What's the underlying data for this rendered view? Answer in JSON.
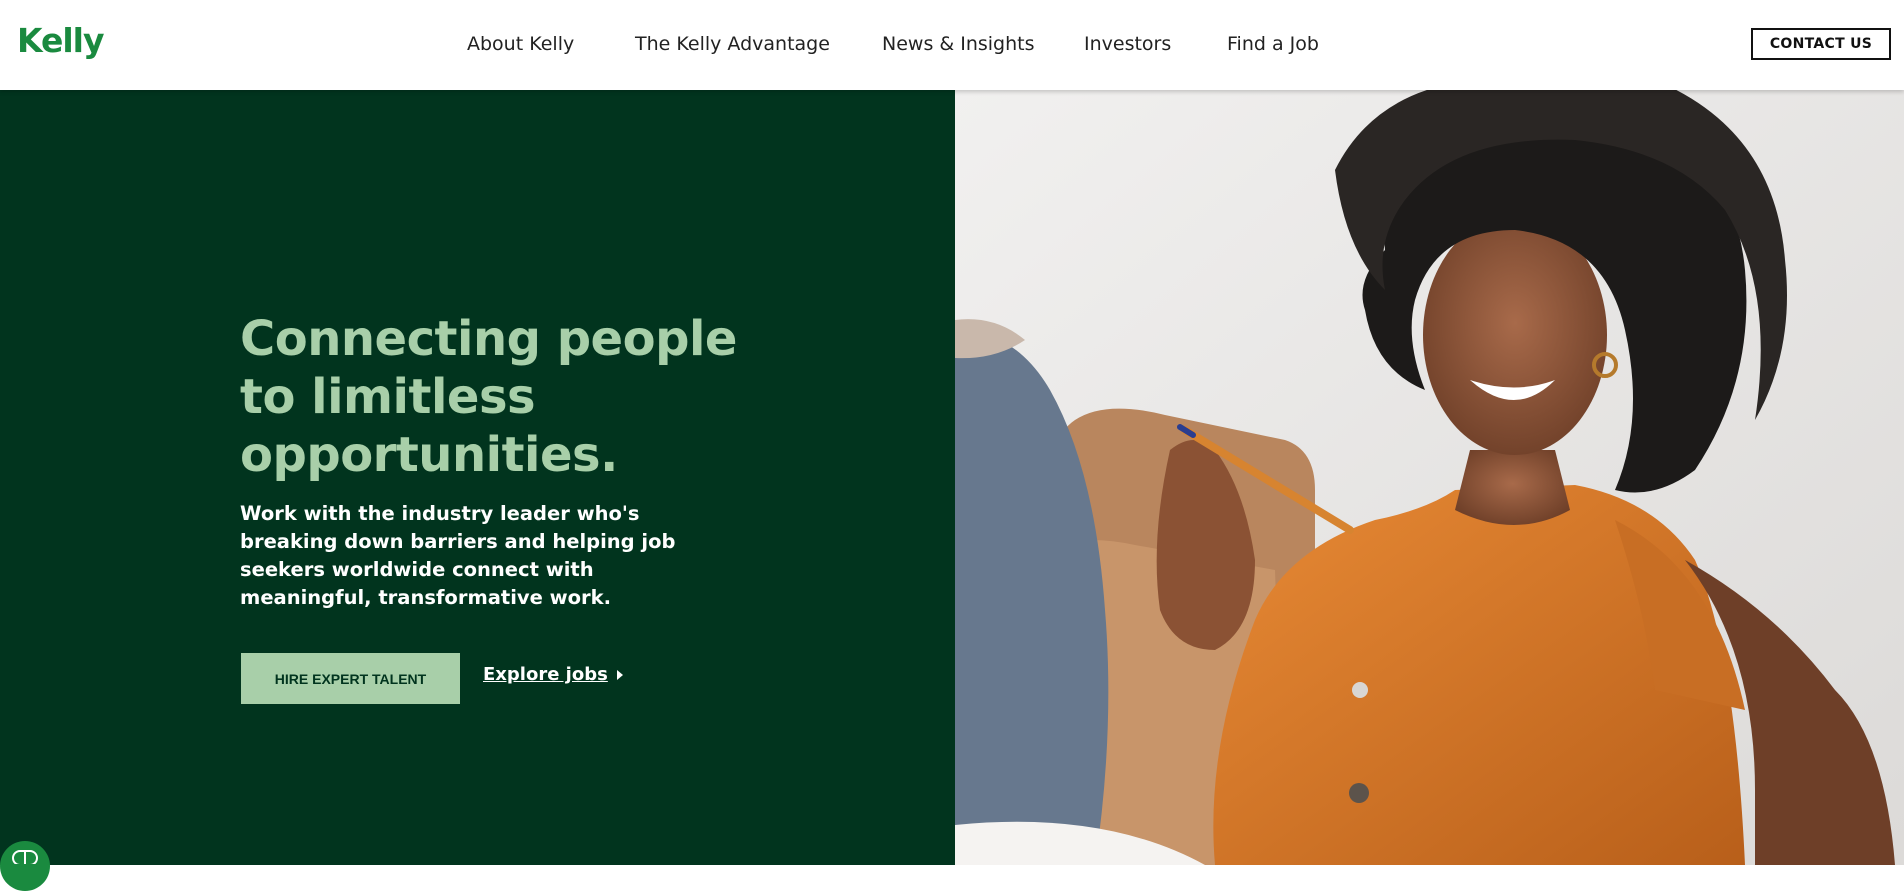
{
  "header": {
    "logo_text": "Kelly",
    "nav": [
      {
        "label": "About Kelly"
      },
      {
        "label": "The Kelly Advantage"
      },
      {
        "label": "News & Insights"
      },
      {
        "label": "Investors"
      },
      {
        "label": "Find a Job"
      }
    ],
    "contact_label": "CONTACT US"
  },
  "hero": {
    "headline": "Connecting people to limitless opportunities.",
    "subtext": "Work with the industry leader who's breaking down barriers and helping job seekers worldwide connect with meaningful, transformative work.",
    "primary_button": "HIRE EXPERT TALENT",
    "secondary_link": "Explore jobs",
    "image_alt": "Smiling woman in orange shirt holding a pen"
  },
  "colors": {
    "brand_green": "#1a8a3f",
    "hero_dark_green": "#01341e",
    "accent_light_green": "#a8cfa9"
  }
}
